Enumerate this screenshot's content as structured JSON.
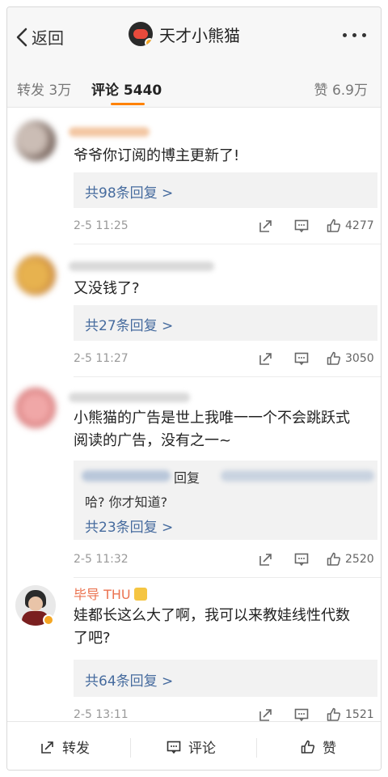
{
  "header": {
    "back_label": "返回",
    "title": "天才小熊猫"
  },
  "tabs": {
    "forward": "转发 3万",
    "comments": "评论 5440",
    "likes": "赞 6.9万"
  },
  "comments": [
    {
      "text": "爷爷你订阅的博主更新了!",
      "replies": "共98条回复 >",
      "time": "2-5 11:25",
      "likes": "4277"
    },
    {
      "text": "又没钱了?",
      "replies": "共27条回复 >",
      "time": "2-5 11:27",
      "likes": "3050"
    },
    {
      "text_line1": "小熊猫的广告是世上我唯一一个不会跳跃式",
      "text_line2": "阅读的广告，没有之一~",
      "reply_preview_mid": "回复",
      "reply_preview_text": "哈? 你才知道?",
      "replies": "共23条回复 >",
      "time": "2-5 11:32",
      "likes": "2520"
    },
    {
      "name": "毕导 THU",
      "text_line1": "娃都长这么大了啊，我可以来教娃线性代数",
      "text_line2": "了吧?",
      "replies": "共64条回复 >",
      "time": "2-5 13:11",
      "likes": "1521"
    }
  ],
  "bottom_bar": {
    "forward": "转发",
    "comment": "评论",
    "like": "赞"
  },
  "colors": {
    "accent": "#ff8200",
    "link": "#466b9e",
    "username": "#eb7350"
  }
}
